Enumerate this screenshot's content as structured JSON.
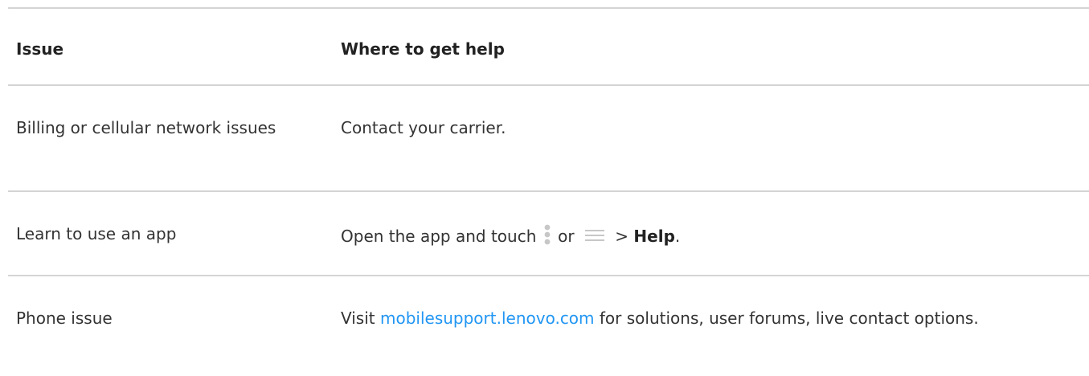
{
  "table": {
    "header": {
      "issue": "Issue",
      "where": "Where to get help"
    },
    "rows": [
      {
        "issue": "Billing or cellular network issues",
        "help": "Contact your carrier."
      },
      {
        "issue": "Learn to use an app",
        "help_prefix": "Open the app and touch",
        "help_or": "or",
        "help_sep": ">",
        "help_bold": "Help",
        "help_end": ".",
        "icons": [
          "more-vert-icon",
          "menu-icon"
        ]
      },
      {
        "issue": "Phone issue",
        "help_prefix": "Visit",
        "help_link": "mobilesupport.lenovo.com",
        "help_suffix": "for solutions, user forums, live contact options."
      }
    ]
  },
  "colors": {
    "text": "#333333",
    "link": "#2196f3",
    "rule": "#d4d4d4",
    "icon": "#c7c7c7"
  }
}
